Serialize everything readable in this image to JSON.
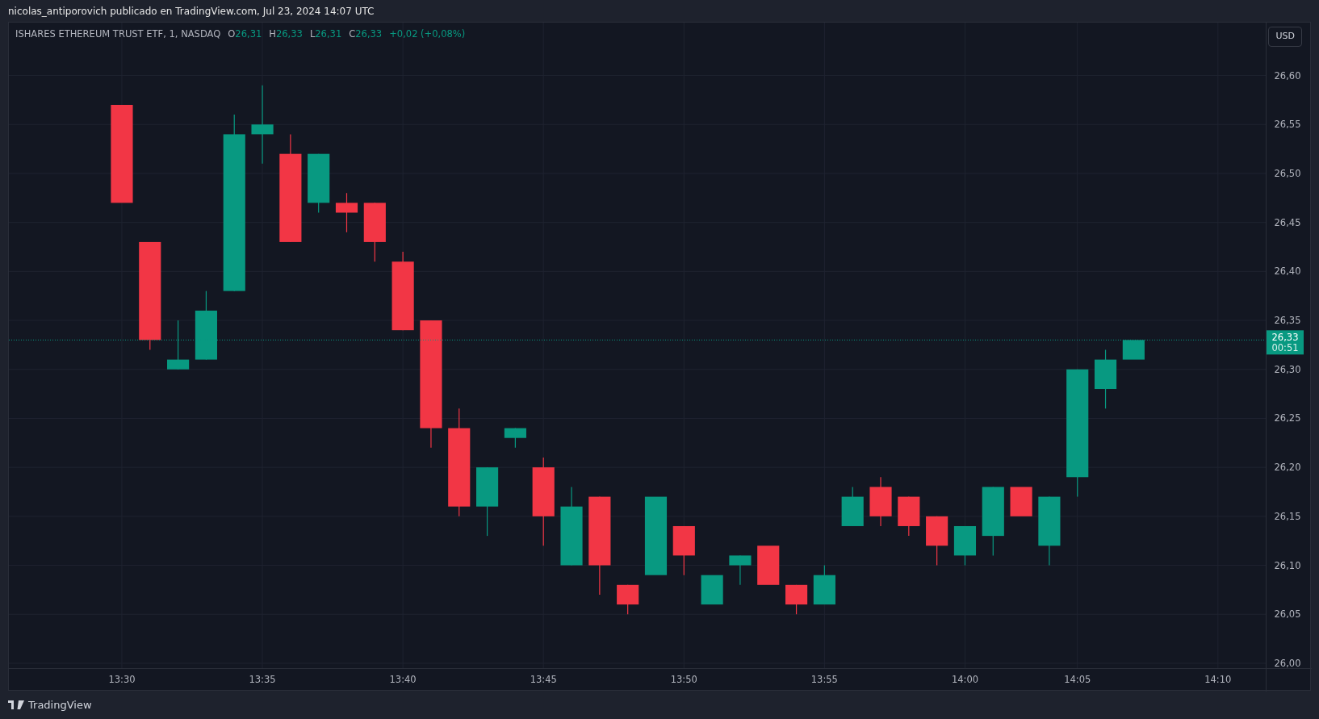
{
  "header": {
    "title": "nicolas_antiporovich publicado en TradingView.com, Jul 23, 2024 14:07 UTC"
  },
  "legend": {
    "symbol": "ISHARES ETHEREUM TRUST ETF, 1, NASDAQ",
    "fields": [
      {
        "label": "O",
        "value": "26,31"
      },
      {
        "label": "H",
        "value": "26,33"
      },
      {
        "label": "L",
        "value": "26,31"
      },
      {
        "label": "C",
        "value": "26,33"
      }
    ],
    "change": "+0,02 (+0,08%)"
  },
  "currency_button": "USD",
  "price_label": {
    "price": "26,33",
    "countdown": "00:51"
  },
  "chart": {
    "y_axis_labels": [
      "26,60",
      "26,55",
      "26,50",
      "26,45",
      "26,40",
      "26,35",
      "26,30",
      "26,25",
      "26,20",
      "26,15",
      "26,10",
      "26,05",
      "26,00"
    ],
    "x_axis_labels": [
      "13:30",
      "13:35",
      "13:40",
      "13:45",
      "13:50",
      "13:55",
      "14:00",
      "14:05",
      "14:10"
    ]
  },
  "footer": {
    "brand": "TradingView"
  }
}
